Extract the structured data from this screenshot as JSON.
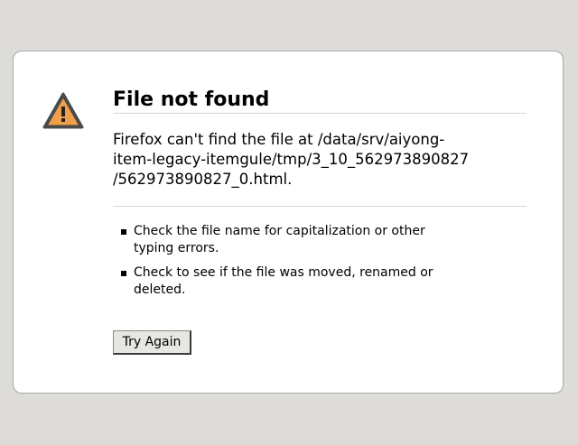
{
  "error": {
    "title": "File not found",
    "message_lines": [
      "Firefox can't find the file at /data/srv/aiyong-",
      "item-legacy-itemgule/tmp/3_10_562973890827",
      "/562973890827_0.html."
    ],
    "tips": [
      {
        "lines": [
          "Check the file name for capitalization or other",
          "typing errors."
        ]
      },
      {
        "lines": [
          "Check to see if the file was moved, renamed or",
          "deleted."
        ]
      }
    ],
    "try_again_label": "Try Again"
  },
  "icon": "warning-triangle-icon",
  "colors": {
    "background": "#dedcd8",
    "box": "#ffffff",
    "warning_fill": "#f0a04b",
    "warning_border": "#4a4a4a"
  }
}
